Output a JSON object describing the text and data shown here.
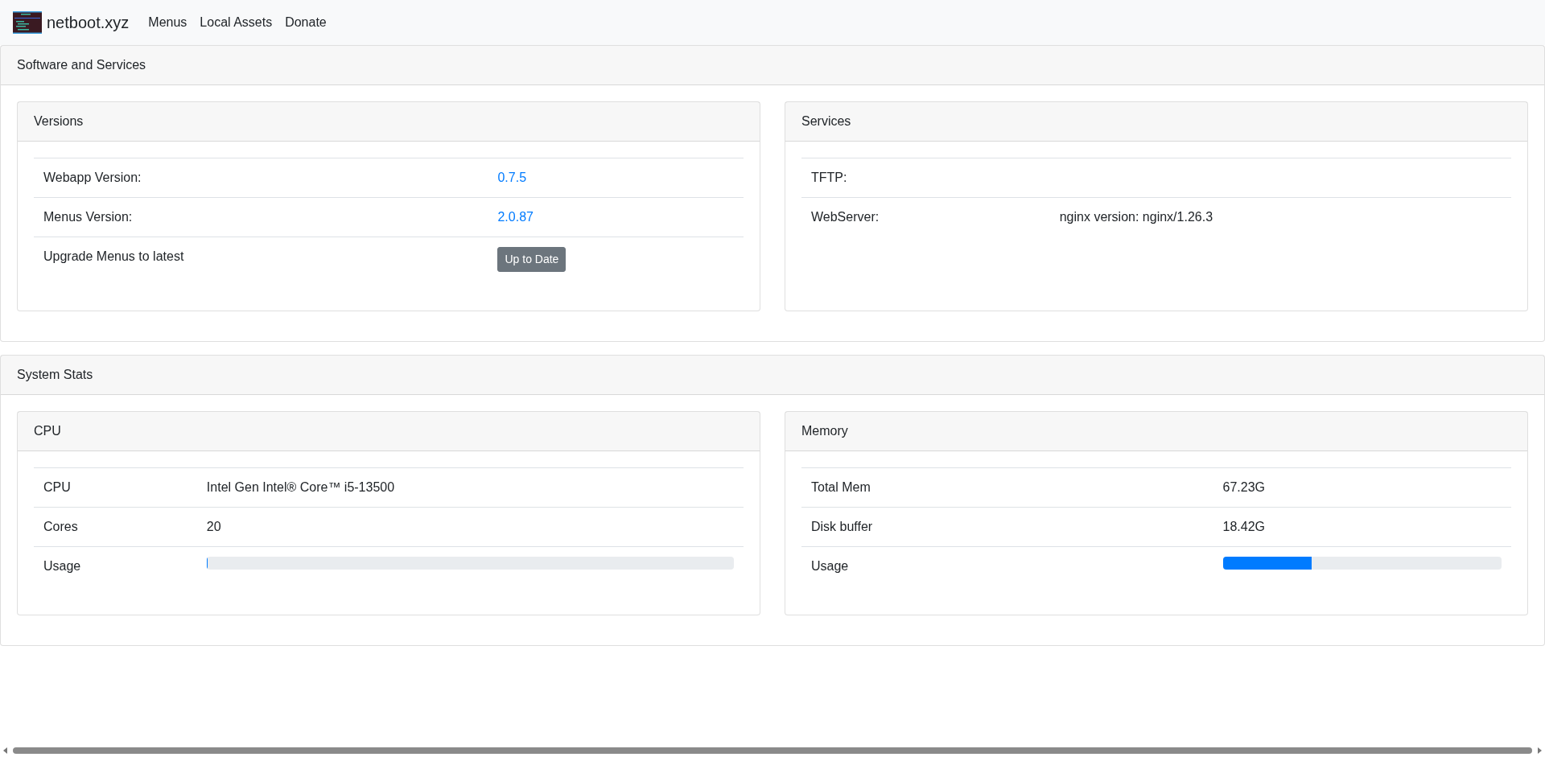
{
  "navbar": {
    "brand": "netboot.xyz",
    "links": [
      "Menus",
      "Local Assets",
      "Donate"
    ]
  },
  "sections": [
    {
      "title": "Software and Services",
      "panels": [
        {
          "title": "Versions",
          "rows": [
            {
              "kind": "link",
              "label": "Webapp Version:",
              "value": "0.7.5"
            },
            {
              "kind": "link",
              "label": "Menus Version:",
              "value": "2.0.87"
            },
            {
              "kind": "button",
              "label": "Upgrade Menus to latest",
              "value": "Up to Date"
            }
          ]
        },
        {
          "title": "Services",
          "rows": [
            {
              "kind": "text",
              "label": "TFTP:"
            },
            {
              "kind": "text",
              "label": "WebServer:",
              "value": "nginx version: nginx/1.26.3"
            }
          ]
        }
      ]
    },
    {
      "title": "System Stats",
      "panels": [
        {
          "title": "CPU",
          "rows": [
            {
              "kind": "text",
              "label": "CPU",
              "value": "Intel Gen Intel® Core™ i5-13500"
            },
            {
              "kind": "text",
              "label": "Cores",
              "value": "20"
            },
            {
              "kind": "progress",
              "label": "Usage",
              "level": 0
            }
          ]
        },
        {
          "title": "Memory",
          "rows": [
            {
              "kind": "text",
              "label": "Total Mem",
              "value": "67.23G"
            },
            {
              "kind": "text",
              "label": "Disk buffer",
              "value": "18.42G"
            },
            {
              "kind": "progress",
              "label": "Usage",
              "level": 0.32
            }
          ]
        }
      ]
    }
  ]
}
